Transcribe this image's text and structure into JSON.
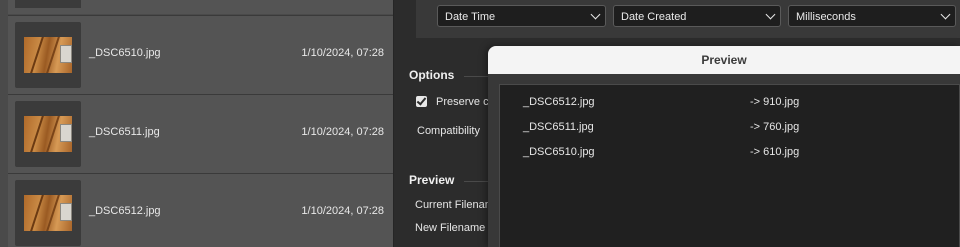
{
  "file_list": {
    "items": [
      {
        "filename": "_DSC6510.jpg",
        "date": "1/10/2024, 07:28"
      },
      {
        "filename": "_DSC6511.jpg",
        "date": "1/10/2024, 07:28"
      },
      {
        "filename": "_DSC6512.jpg",
        "date": "1/10/2024, 07:28"
      }
    ]
  },
  "settings": {
    "dropdowns": {
      "format": "Date Time",
      "source": "Date Created",
      "precision": "Milliseconds"
    },
    "options_heading": "Options",
    "preserve_label": "Preserve cu",
    "compatibility_label": "Compatibility",
    "preview_heading": "Preview",
    "current_filename_label": "Current Filenam",
    "new_filename_label": "New Filename"
  },
  "preview_dialog": {
    "title": "Preview",
    "rows": [
      {
        "from": "_DSC6512.jpg",
        "to": "-> 910.jpg"
      },
      {
        "from": "_DSC6511.jpg",
        "to": "-> 760.jpg"
      },
      {
        "from": "_DSC6510.jpg",
        "to": "-> 610.jpg"
      }
    ]
  }
}
